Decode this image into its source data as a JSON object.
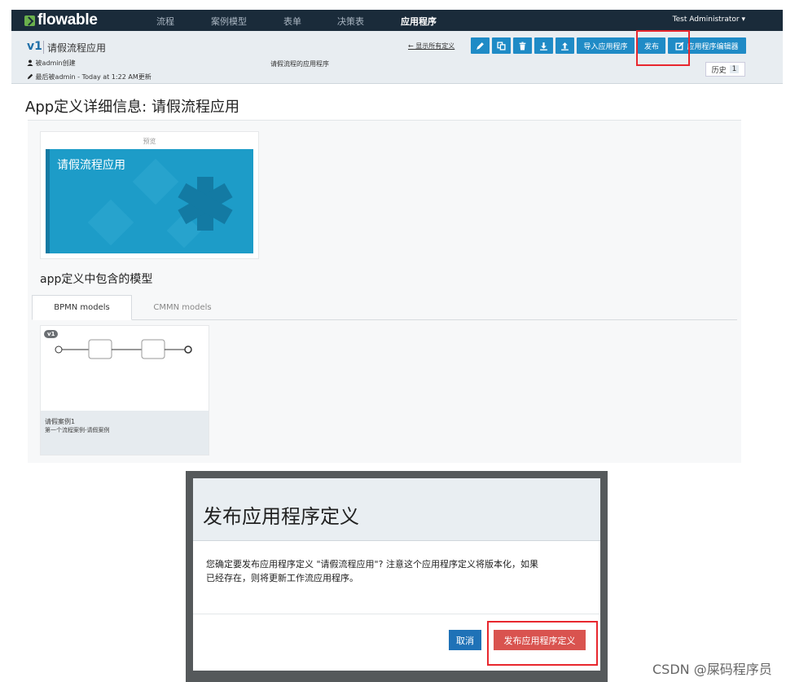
{
  "nav": {
    "logo": "flowable",
    "items": [
      "流程",
      "案例模型",
      "表单",
      "决策表",
      "应用程序"
    ],
    "active_item": "应用程序",
    "user": "Test Administrator ▾"
  },
  "header": {
    "version": "v1",
    "app_name": "请假流程应用",
    "created_by": "被admin创建",
    "updated": "最后被admin - Today at 1:22 AM更新",
    "description": "请假流程的应用程序",
    "show_all": "← 显示所有定义",
    "import_label": "导入应用程序",
    "publish_label": "发布",
    "editor_label": "应用程序编辑器",
    "history_label": "历史",
    "history_count": "1"
  },
  "content": {
    "page_title": "App定义详细信息: 请假流程应用",
    "preview_label": "预览",
    "tile_title": "请假流程应用",
    "models_title": "app定义中包含的模型",
    "tabs": [
      "BPMN models",
      "CMMN models"
    ],
    "model": {
      "version": "v1",
      "name": "请假案例1",
      "description": "第一个流程案例-请假案例"
    }
  },
  "modal": {
    "title": "发布应用程序定义",
    "body_line1": "您确定要发布应用程序定义 \"请假流程应用\"? 注意这个应用程序定义将版本化，如果",
    "body_line2": "已经存在，则将更新工作流应用程序。",
    "cancel_label": "取消",
    "confirm_label": "发布应用程序定义"
  },
  "watermark": "CSDN @屎码程序员",
  "colors": {
    "nav_bg": "#1a2b3a",
    "primary": "#1f8bc6",
    "tile": "#1d9cc8",
    "danger": "#d9534f",
    "highlight": "#e8272e"
  }
}
